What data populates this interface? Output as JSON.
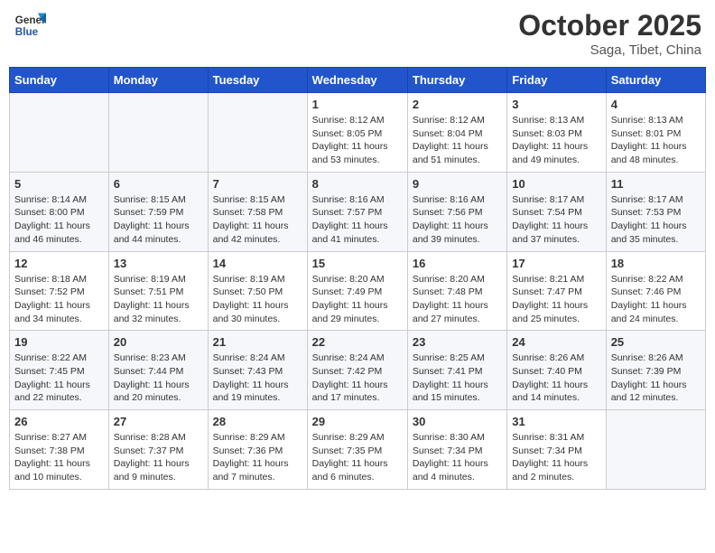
{
  "header": {
    "logo_line1": "General",
    "logo_line2": "Blue",
    "month": "October 2025",
    "location": "Saga, Tibet, China"
  },
  "weekdays": [
    "Sunday",
    "Monday",
    "Tuesday",
    "Wednesday",
    "Thursday",
    "Friday",
    "Saturday"
  ],
  "weeks": [
    [
      {
        "day": "",
        "info": ""
      },
      {
        "day": "",
        "info": ""
      },
      {
        "day": "",
        "info": ""
      },
      {
        "day": "1",
        "info": "Sunrise: 8:12 AM\nSunset: 8:05 PM\nDaylight: 11 hours\nand 53 minutes."
      },
      {
        "day": "2",
        "info": "Sunrise: 8:12 AM\nSunset: 8:04 PM\nDaylight: 11 hours\nand 51 minutes."
      },
      {
        "day": "3",
        "info": "Sunrise: 8:13 AM\nSunset: 8:03 PM\nDaylight: 11 hours\nand 49 minutes."
      },
      {
        "day": "4",
        "info": "Sunrise: 8:13 AM\nSunset: 8:01 PM\nDaylight: 11 hours\nand 48 minutes."
      }
    ],
    [
      {
        "day": "5",
        "info": "Sunrise: 8:14 AM\nSunset: 8:00 PM\nDaylight: 11 hours\nand 46 minutes."
      },
      {
        "day": "6",
        "info": "Sunrise: 8:15 AM\nSunset: 7:59 PM\nDaylight: 11 hours\nand 44 minutes."
      },
      {
        "day": "7",
        "info": "Sunrise: 8:15 AM\nSunset: 7:58 PM\nDaylight: 11 hours\nand 42 minutes."
      },
      {
        "day": "8",
        "info": "Sunrise: 8:16 AM\nSunset: 7:57 PM\nDaylight: 11 hours\nand 41 minutes."
      },
      {
        "day": "9",
        "info": "Sunrise: 8:16 AM\nSunset: 7:56 PM\nDaylight: 11 hours\nand 39 minutes."
      },
      {
        "day": "10",
        "info": "Sunrise: 8:17 AM\nSunset: 7:54 PM\nDaylight: 11 hours\nand 37 minutes."
      },
      {
        "day": "11",
        "info": "Sunrise: 8:17 AM\nSunset: 7:53 PM\nDaylight: 11 hours\nand 35 minutes."
      }
    ],
    [
      {
        "day": "12",
        "info": "Sunrise: 8:18 AM\nSunset: 7:52 PM\nDaylight: 11 hours\nand 34 minutes."
      },
      {
        "day": "13",
        "info": "Sunrise: 8:19 AM\nSunset: 7:51 PM\nDaylight: 11 hours\nand 32 minutes."
      },
      {
        "day": "14",
        "info": "Sunrise: 8:19 AM\nSunset: 7:50 PM\nDaylight: 11 hours\nand 30 minutes."
      },
      {
        "day": "15",
        "info": "Sunrise: 8:20 AM\nSunset: 7:49 PM\nDaylight: 11 hours\nand 29 minutes."
      },
      {
        "day": "16",
        "info": "Sunrise: 8:20 AM\nSunset: 7:48 PM\nDaylight: 11 hours\nand 27 minutes."
      },
      {
        "day": "17",
        "info": "Sunrise: 8:21 AM\nSunset: 7:47 PM\nDaylight: 11 hours\nand 25 minutes."
      },
      {
        "day": "18",
        "info": "Sunrise: 8:22 AM\nSunset: 7:46 PM\nDaylight: 11 hours\nand 24 minutes."
      }
    ],
    [
      {
        "day": "19",
        "info": "Sunrise: 8:22 AM\nSunset: 7:45 PM\nDaylight: 11 hours\nand 22 minutes."
      },
      {
        "day": "20",
        "info": "Sunrise: 8:23 AM\nSunset: 7:44 PM\nDaylight: 11 hours\nand 20 minutes."
      },
      {
        "day": "21",
        "info": "Sunrise: 8:24 AM\nSunset: 7:43 PM\nDaylight: 11 hours\nand 19 minutes."
      },
      {
        "day": "22",
        "info": "Sunrise: 8:24 AM\nSunset: 7:42 PM\nDaylight: 11 hours\nand 17 minutes."
      },
      {
        "day": "23",
        "info": "Sunrise: 8:25 AM\nSunset: 7:41 PM\nDaylight: 11 hours\nand 15 minutes."
      },
      {
        "day": "24",
        "info": "Sunrise: 8:26 AM\nSunset: 7:40 PM\nDaylight: 11 hours\nand 14 minutes."
      },
      {
        "day": "25",
        "info": "Sunrise: 8:26 AM\nSunset: 7:39 PM\nDaylight: 11 hours\nand 12 minutes."
      }
    ],
    [
      {
        "day": "26",
        "info": "Sunrise: 8:27 AM\nSunset: 7:38 PM\nDaylight: 11 hours\nand 10 minutes."
      },
      {
        "day": "27",
        "info": "Sunrise: 8:28 AM\nSunset: 7:37 PM\nDaylight: 11 hours\nand 9 minutes."
      },
      {
        "day": "28",
        "info": "Sunrise: 8:29 AM\nSunset: 7:36 PM\nDaylight: 11 hours\nand 7 minutes."
      },
      {
        "day": "29",
        "info": "Sunrise: 8:29 AM\nSunset: 7:35 PM\nDaylight: 11 hours\nand 6 minutes."
      },
      {
        "day": "30",
        "info": "Sunrise: 8:30 AM\nSunset: 7:34 PM\nDaylight: 11 hours\nand 4 minutes."
      },
      {
        "day": "31",
        "info": "Sunrise: 8:31 AM\nSunset: 7:34 PM\nDaylight: 11 hours\nand 2 minutes."
      },
      {
        "day": "",
        "info": ""
      }
    ]
  ]
}
